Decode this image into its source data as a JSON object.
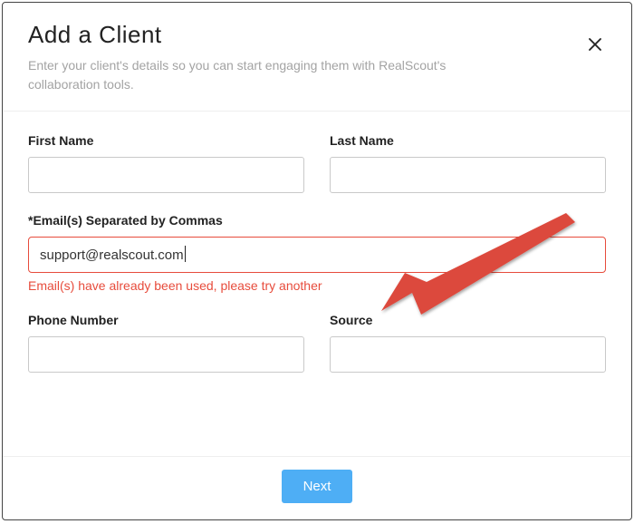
{
  "header": {
    "title": "Add a Client",
    "subtitle": "Enter your client's details so you can start engaging them with RealScout's collaboration tools."
  },
  "fields": {
    "first_name": {
      "label": "First Name",
      "value": ""
    },
    "last_name": {
      "label": "Last Name",
      "value": ""
    },
    "email": {
      "label": "*Email(s) Separated by Commas",
      "value": "support@realscout.com",
      "error": "Email(s) have already been used, please try another"
    },
    "phone": {
      "label": "Phone Number",
      "value": ""
    },
    "source": {
      "label": "Source",
      "value": ""
    }
  },
  "footer": {
    "next_label": "Next"
  }
}
